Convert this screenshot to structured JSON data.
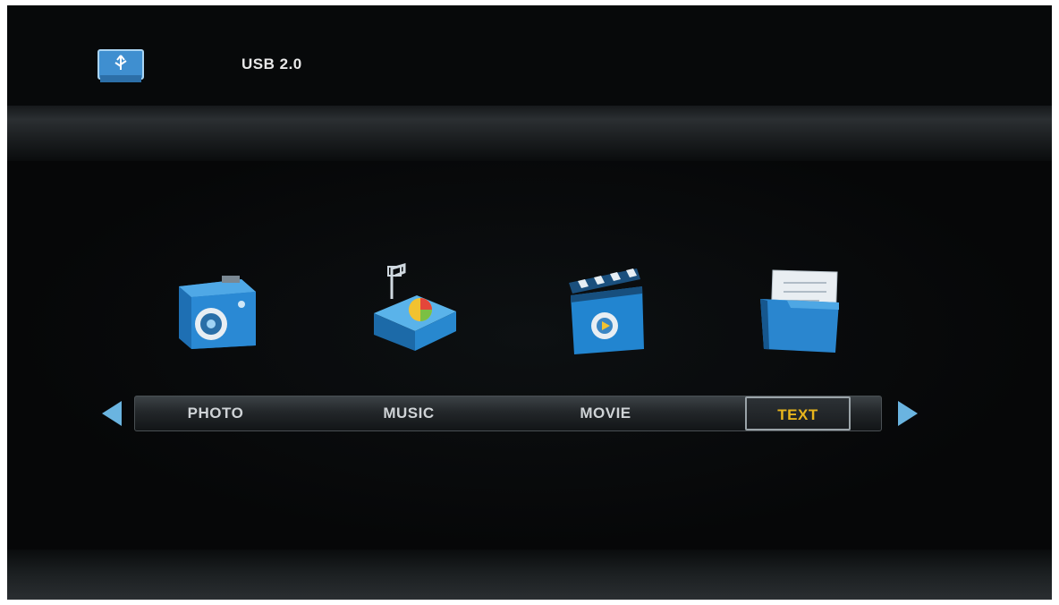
{
  "header": {
    "source_icon": "usb-drive-icon",
    "source_label": "USB 2.0"
  },
  "menu": {
    "items": [
      {
        "label": "PHOTO",
        "icon": "camera-icon"
      },
      {
        "label": "MUSIC",
        "icon": "music-box-icon"
      },
      {
        "label": "MOVIE",
        "icon": "clapperboard-icon"
      },
      {
        "label": "TEXT",
        "icon": "folder-document-icon"
      }
    ],
    "selected": "TEXT",
    "prev_icon": "arrow-left-icon",
    "next_icon": "arrow-right-icon"
  },
  "colors": {
    "background": "#060708",
    "selected_text": "#e8b51c",
    "tab_text": "#cfd3d6",
    "icon_blue": "#1e7fc8",
    "arrow_blue": "#6ab4e0"
  }
}
